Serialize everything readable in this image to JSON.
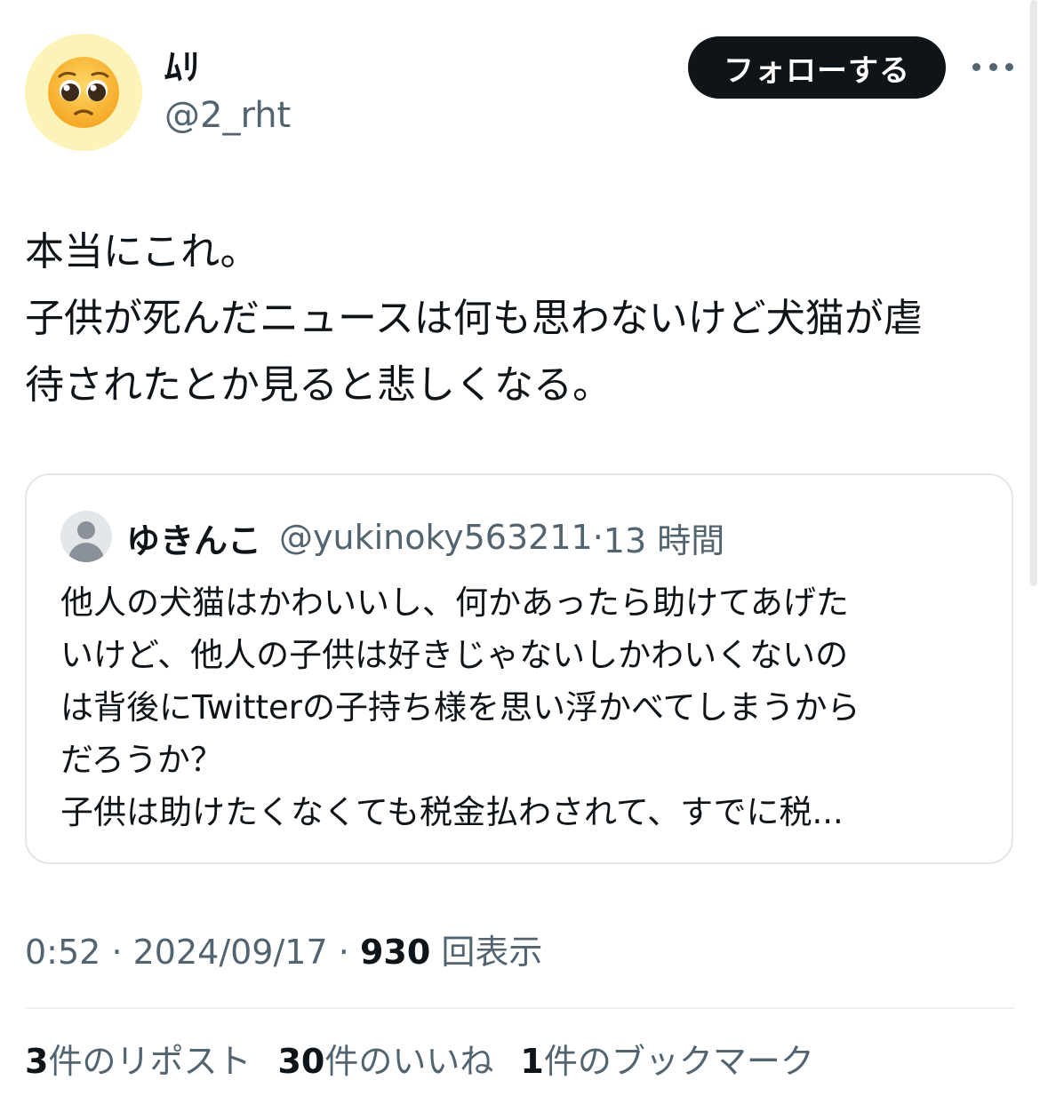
{
  "author": {
    "avatar_icon": "pleading-face-icon",
    "display_name": "ﾑﾘ",
    "handle": "@2_rht"
  },
  "actions": {
    "follow_label": "フォローする",
    "more_icon": "more-options-icon"
  },
  "tweet": {
    "text": "本当にこれ。\n子供が死んだニュースは何も思わないけど犬猫が虐\n待されたとか見ると悲しくなる。"
  },
  "quote": {
    "avatar_icon": "default-user-icon",
    "display_name": "ゆきんこ",
    "handle": "@yukinoky563211",
    "sep": "·",
    "time": "13 時間",
    "text": "他人の犬猫はかわいいし、何かあったら助けてあげた\nいけど、他人の子供は好きじゃないしかわいくないの\nは背後にTwitterの子持ち様を思い浮かべてしまうから\nだろうか？\n子供は助けたくなくても税金払わされて、すでに税..."
  },
  "meta": {
    "time": "0:52",
    "sep1": "·",
    "date": "2024/09/17",
    "sep2": "·",
    "views_count": "930",
    "views_label": "回表示"
  },
  "stats": {
    "reposts_count": "3",
    "reposts_label": "件のリポスト",
    "likes_count": "30",
    "likes_label": "件のいいね",
    "bookmarks_count": "1",
    "bookmarks_label": "件のブックマーク"
  },
  "colors": {
    "text": "#0f1419",
    "secondary": "#536471",
    "avatar_bg": "#fcf3b8",
    "button_bg": "#0f1419",
    "border": "#e3e6e9"
  }
}
